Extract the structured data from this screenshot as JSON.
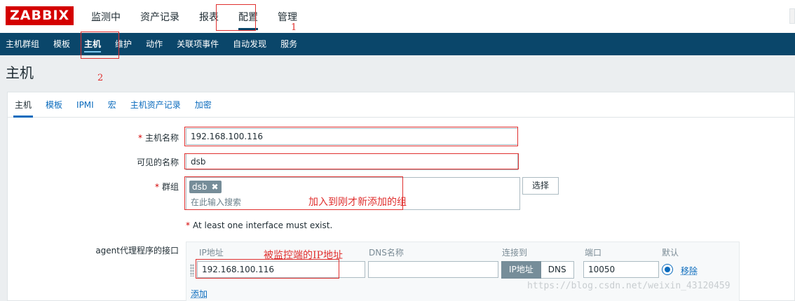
{
  "logo": "ZABBIX",
  "top_menu": [
    {
      "label": "监测中"
    },
    {
      "label": "资产记录"
    },
    {
      "label": "报表"
    },
    {
      "label": "配置",
      "active": true
    },
    {
      "label": "管理"
    }
  ],
  "sub_menu": [
    {
      "label": "主机群组"
    },
    {
      "label": "模板"
    },
    {
      "label": "主机",
      "active": true
    },
    {
      "label": "维护"
    },
    {
      "label": "动作"
    },
    {
      "label": "关联项事件"
    },
    {
      "label": "自动发现"
    },
    {
      "label": "服务"
    }
  ],
  "page_title": "主机",
  "tabs": [
    {
      "label": "主机",
      "active": true
    },
    {
      "label": "模板"
    },
    {
      "label": "IPMI"
    },
    {
      "label": "宏"
    },
    {
      "label": "主机资产记录"
    },
    {
      "label": "加密"
    }
  ],
  "form": {
    "host_name_label": "主机名称",
    "host_name_value": "192.168.100.116",
    "visible_name_label": "可见的名称",
    "visible_name_value": "dsb",
    "groups_label": "群组",
    "group_chip": "dsb",
    "group_chip_remove": "✖",
    "group_placeholder": "在此输入搜索",
    "select_button": "选择",
    "required_mark": "*",
    "interface_warning": "At least one interface must exist."
  },
  "interfaces": {
    "label": "agent代理程序的接口",
    "headers": {
      "ip": "IP地址",
      "dns": "DNS名称",
      "connect": "连接到",
      "port": "端口",
      "default": "默认"
    },
    "row": {
      "ip": "192.168.100.116",
      "dns": "",
      "connect_ip": "IP地址",
      "connect_dns": "DNS",
      "port": "10050",
      "remove": "移除"
    },
    "add": "添加"
  },
  "annotations": {
    "num1": "1",
    "num2": "2",
    "group_note": "加入到刚才新添加的组",
    "ip_note": "被监控端的IP地址"
  },
  "watermark": "https://blog.csdn.net/weixin_43120459",
  "colors": {
    "brand": "#d40000",
    "nav": "#0a466a",
    "link": "#0a6bbd",
    "annotation": "#e0302f"
  }
}
